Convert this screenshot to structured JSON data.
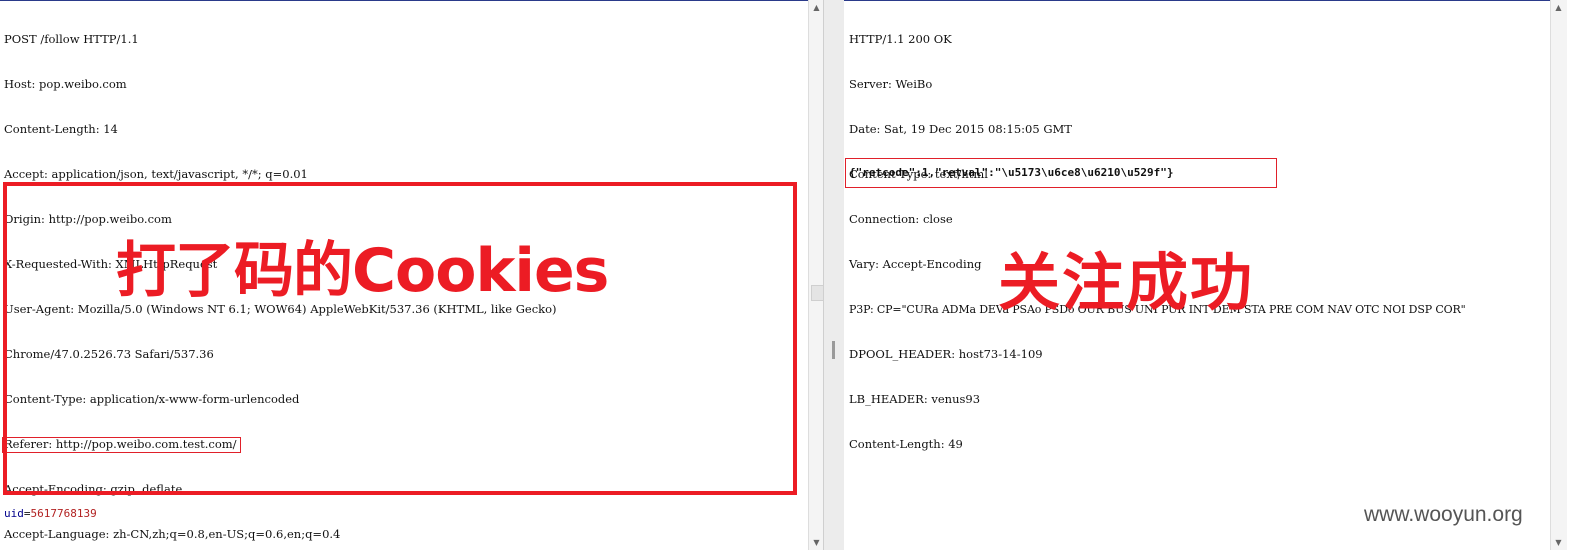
{
  "request": {
    "lines": [
      "POST /follow HTTP/1.1",
      "Host: pop.weibo.com",
      "Content-Length: 14",
      "Accept: application/json, text/javascript, */*; q=0.01",
      "Origin: http://pop.weibo.com",
      "X-Requested-With: XMLHttpRequest",
      "User-Agent: Mozilla/5.0 (Windows NT 6.1; WOW64) AppleWebKit/537.36 (KHTML, like Gecko)",
      "Chrome/47.0.2526.73 Safari/537.36",
      "Content-Type: application/x-www-form-urlencoded",
      "Referer: http://pop.weibo.com.test.com/",
      "Accept-Encoding: gzip, deflate",
      "Accept-Language: zh-CN,zh;q=0.8,en-US;q=0.6,en;q=0.4"
    ],
    "highlighted_line_index": 9,
    "cookies_annotation": "打了码的Cookies",
    "body": {
      "key": "uid",
      "eq": "=",
      "value": "5617768139"
    }
  },
  "response": {
    "lines": [
      "HTTP/1.1 200 OK",
      "Server: WeiBo",
      "Date: Sat, 19 Dec 2015 08:15:05 GMT",
      "Content-Type: text/html",
      "Connection: close",
      "Vary: Accept-Encoding",
      "P3P: CP=\"CURa ADMa DEVa PSAo PSDo OUR BUS UNI PUR INT DEM STA PRE COM NAV OTC NOI DSP COR\"",
      "DPOOL_HEADER: host73-14-109",
      "LB_HEADER: venus93",
      "Content-Length: 49"
    ],
    "body_json": "{\"retcode\":1,\"retval\":\"\\u5173\\u6ce8\\u6210\\u529f\"}",
    "success_annotation": "关注成功"
  },
  "watermark": "www.wooyun.org",
  "colors": {
    "annotation_red": "#ec1c24",
    "uid_key": "#00008b",
    "uid_value": "#b22222",
    "border_blue": "#2a3a8a"
  }
}
